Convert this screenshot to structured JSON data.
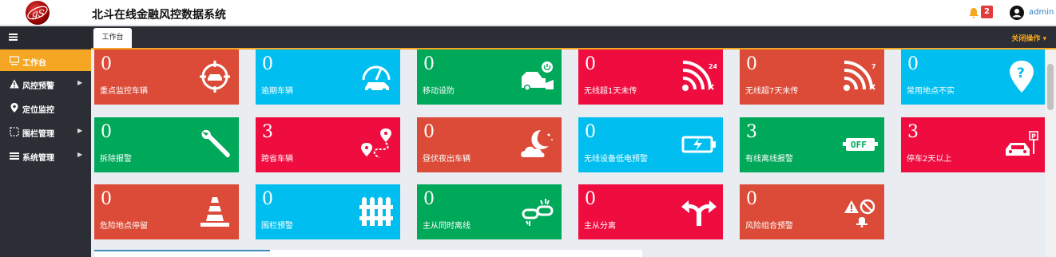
{
  "header": {
    "title": "北斗在线金融风控数据系统",
    "notification_count": "2",
    "username": "admin"
  },
  "sidebar": {
    "items": [
      {
        "label": "工作台",
        "icon": "monitor-icon",
        "active": true
      },
      {
        "label": "风控预警",
        "icon": "warning-icon",
        "has_submenu": true
      },
      {
        "label": "定位监控",
        "icon": "map-pin-icon"
      },
      {
        "label": "围栏管理",
        "icon": "fence-icon",
        "has_submenu": true
      },
      {
        "label": "系统管理",
        "icon": "system-icon",
        "has_submenu": true
      }
    ]
  },
  "tabs": {
    "active": "工作台",
    "close_ops": "关闭操作"
  },
  "cards": [
    {
      "value": "0",
      "label": "重点监控车辆",
      "color": "#db4b38",
      "icon": "target-car-icon"
    },
    {
      "value": "0",
      "label": "逾期车辆",
      "color": "#00bff0",
      "icon": "speedometer-car-icon"
    },
    {
      "value": "0",
      "label": "移动设防",
      "color": "#00a85a",
      "icon": "car-power-icon"
    },
    {
      "value": "0",
      "label": "无线超1天未传",
      "color": "#ef0d40",
      "icon": "signal-24-icon"
    },
    {
      "value": "0",
      "label": "无线超7天未传",
      "color": "#db4b38",
      "icon": "signal-7-icon"
    },
    {
      "value": "0",
      "label": "常用地点不实",
      "color": "#00bff0",
      "icon": "question-pin-icon"
    },
    {
      "value": "0",
      "label": "拆除报警",
      "color": "#00a85a",
      "icon": "wrench-icon"
    },
    {
      "value": "3",
      "label": "跨省车辆",
      "color": "#ef0d40",
      "icon": "route-icon"
    },
    {
      "value": "0",
      "label": "昼伏夜出车辆",
      "color": "#db4b38",
      "icon": "moon-cloud-icon"
    },
    {
      "value": "0",
      "label": "无线设备低电预警",
      "color": "#00bff0",
      "icon": "battery-icon"
    },
    {
      "value": "3",
      "label": "有线离线报警",
      "color": "#00a85a",
      "icon": "off-switch-icon"
    },
    {
      "value": "3",
      "label": "停车2天以上",
      "color": "#ef0d40",
      "icon": "parking-icon"
    },
    {
      "value": "0",
      "label": "危险地点停留",
      "color": "#db4b38",
      "icon": "traffic-cone-icon"
    },
    {
      "value": "0",
      "label": "围栏预警",
      "color": "#00bff0",
      "icon": "fence-icon"
    },
    {
      "value": "0",
      "label": "主从同时离线",
      "color": "#00a85a",
      "icon": "broken-link-icon"
    },
    {
      "value": "0",
      "label": "主从分离",
      "color": "#ef0d40",
      "icon": "split-arrow-icon"
    },
    {
      "value": "0",
      "label": "风险组合预警",
      "color": "#db4b38",
      "icon": "alert-combo-icon"
    }
  ]
}
